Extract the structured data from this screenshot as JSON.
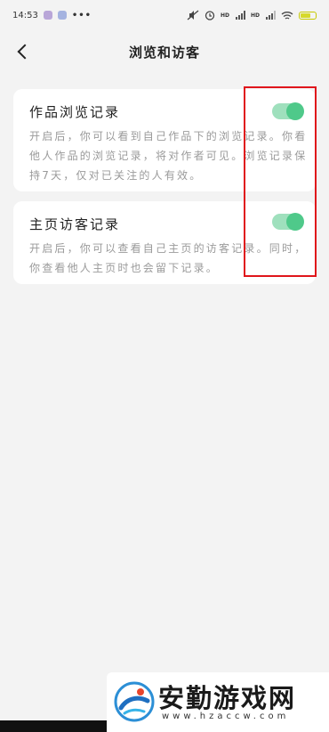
{
  "status_bar": {
    "time": "14:53",
    "more": "•••",
    "hd1": "HD",
    "hd2": "HD",
    "battery_color": "#d6d92a"
  },
  "header": {
    "title": "浏览和访客"
  },
  "settings": [
    {
      "title": "作品浏览记录",
      "description": "开启后，你可以看到自己作品下的浏览记录。你看他人作品的浏览记录，将对作者可见。浏览记录保持7天，仅对已关注的人有效。",
      "enabled": true
    },
    {
      "title": "主页访客记录",
      "description": "开启后，你可以查看自己主页的访客记录。同时，你查看他人主页时也会留下记录。",
      "enabled": true
    }
  ],
  "colors": {
    "toggle_on_track": "#9fe0bd",
    "toggle_on_knob": "#4fc98a",
    "highlight": "#e0151b"
  },
  "watermark": {
    "text": "安勤游戏网",
    "url": "www.hzaccw.com"
  }
}
